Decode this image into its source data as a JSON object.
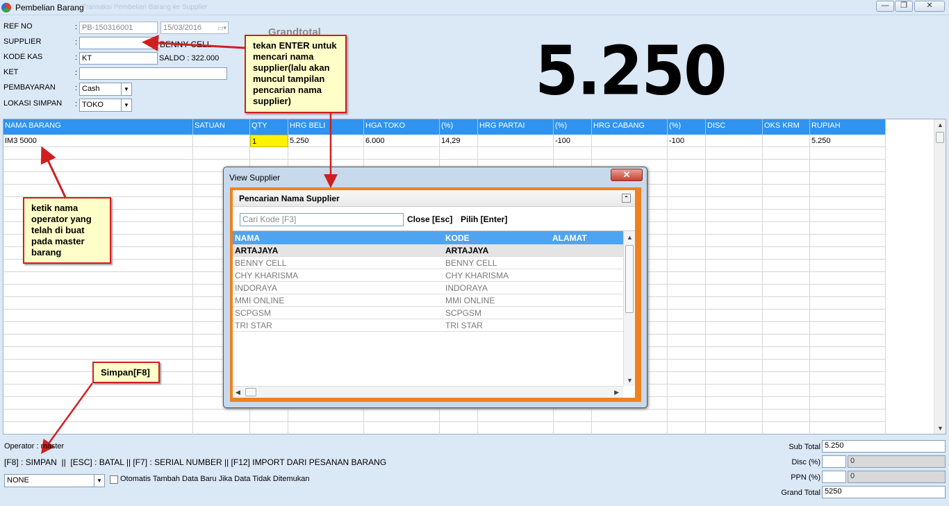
{
  "window": {
    "title": "Pembelian Barang",
    "ghost_title": "Transaksi Pembelian Barang ke Supplier",
    "min": "—",
    "max": "❐",
    "close": "✕"
  },
  "form": {
    "ref_no_label": "REF NO",
    "ref_no_value": "PB-150316001",
    "date_value": "15/03/2016",
    "supplier_label": "SUPPLIER",
    "supplier_value": "",
    "supplier_name": "BENNY CELL",
    "kode_kas_label": "KODE KAS",
    "kode_kas_value": "KT",
    "saldo_text": "SALDO : 322.000",
    "ket_label": "KET",
    "ket_value": "",
    "pembayaran_label": "PEMBAYARAN",
    "pembayaran_value": "Cash",
    "lokasi_label": "LOKASI SIMPAN",
    "lokasi_value": "TOKO",
    "colon": ":"
  },
  "grandtotal": {
    "label": "Grandtotal",
    "value": "5.250"
  },
  "grid": {
    "columns": [
      "NAMA BARANG",
      "SATUAN",
      "QTY",
      "HRG BELI",
      "HGA TOKO",
      "(%)",
      "HRG PARTAI",
      "(%)",
      "HRG CABANG",
      "(%)",
      "DISC",
      "OKS KRM",
      "RUPIAH"
    ],
    "rows": [
      [
        "IM3 5000",
        "",
        "1",
        "5.250",
        "6.000",
        "14,29",
        "",
        "-100",
        "",
        "-100",
        "",
        "",
        "5.250"
      ]
    ]
  },
  "dialog": {
    "title": "View Supplier",
    "close": "✕",
    "panel_title": "Pencarian Nama Supplier",
    "collapse": "⌃",
    "search_placeholder": "Cari Kode [F3]",
    "close_link": "Close [Esc]",
    "pick_link": "Pilih [Enter]",
    "columns": [
      "NAMA",
      "KODE",
      "ALAMAT"
    ],
    "rows": [
      {
        "nama": "ARTAJAYA",
        "kode": "ARTAJAYA",
        "alamat": ""
      },
      {
        "nama": "BENNY CELL",
        "kode": "BENNY CELL",
        "alamat": ""
      },
      {
        "nama": "CHY KHARISMA",
        "kode": "CHY KHARISMA",
        "alamat": ""
      },
      {
        "nama": "INDORAYA",
        "kode": "INDORAYA",
        "alamat": ""
      },
      {
        "nama": "MMI ONLINE",
        "kode": "MMI ONLINE",
        "alamat": ""
      },
      {
        "nama": "SCPGSM",
        "kode": "SCPGSM",
        "alamat": ""
      },
      {
        "nama": "TRI STAR",
        "kode": "TRI STAR",
        "alamat": ""
      }
    ]
  },
  "callouts": {
    "enter": "tekan ENTER untuk mencari nama supplier(lalu akan muncul tampilan pencarian nama supplier)",
    "operator": "ketik nama operator yang telah di buat pada master barang",
    "simpan": "Simpan[F8]"
  },
  "footer": {
    "operator": "Operator : master",
    "shortcuts": "[F8] : SIMPAN  ||  [ESC] : BATAL || [F7] : SERIAL NUMBER || [F12] IMPORT DARI PESANAN BARANG",
    "mode_value": "NONE",
    "auto_add_label": "Otomatis Tambah Data Baru Jika Data Tidak Ditemukan"
  },
  "totals": {
    "sub_total_label": "Sub Total",
    "sub_total_value": "5.250",
    "disc_label": "Disc (%)",
    "disc_pct": "",
    "disc_value": "0",
    "ppn_label": "PPN (%)",
    "ppn_pct": "",
    "ppn_value": "0",
    "grand_total_label": "Grand Total",
    "grand_total_value": "5250"
  },
  "colors": {
    "grid_header": "#2f93ef",
    "dialog_frame": "#f0811f",
    "callout_bg": "#fefec8",
    "arrow": "#d01f1f"
  }
}
